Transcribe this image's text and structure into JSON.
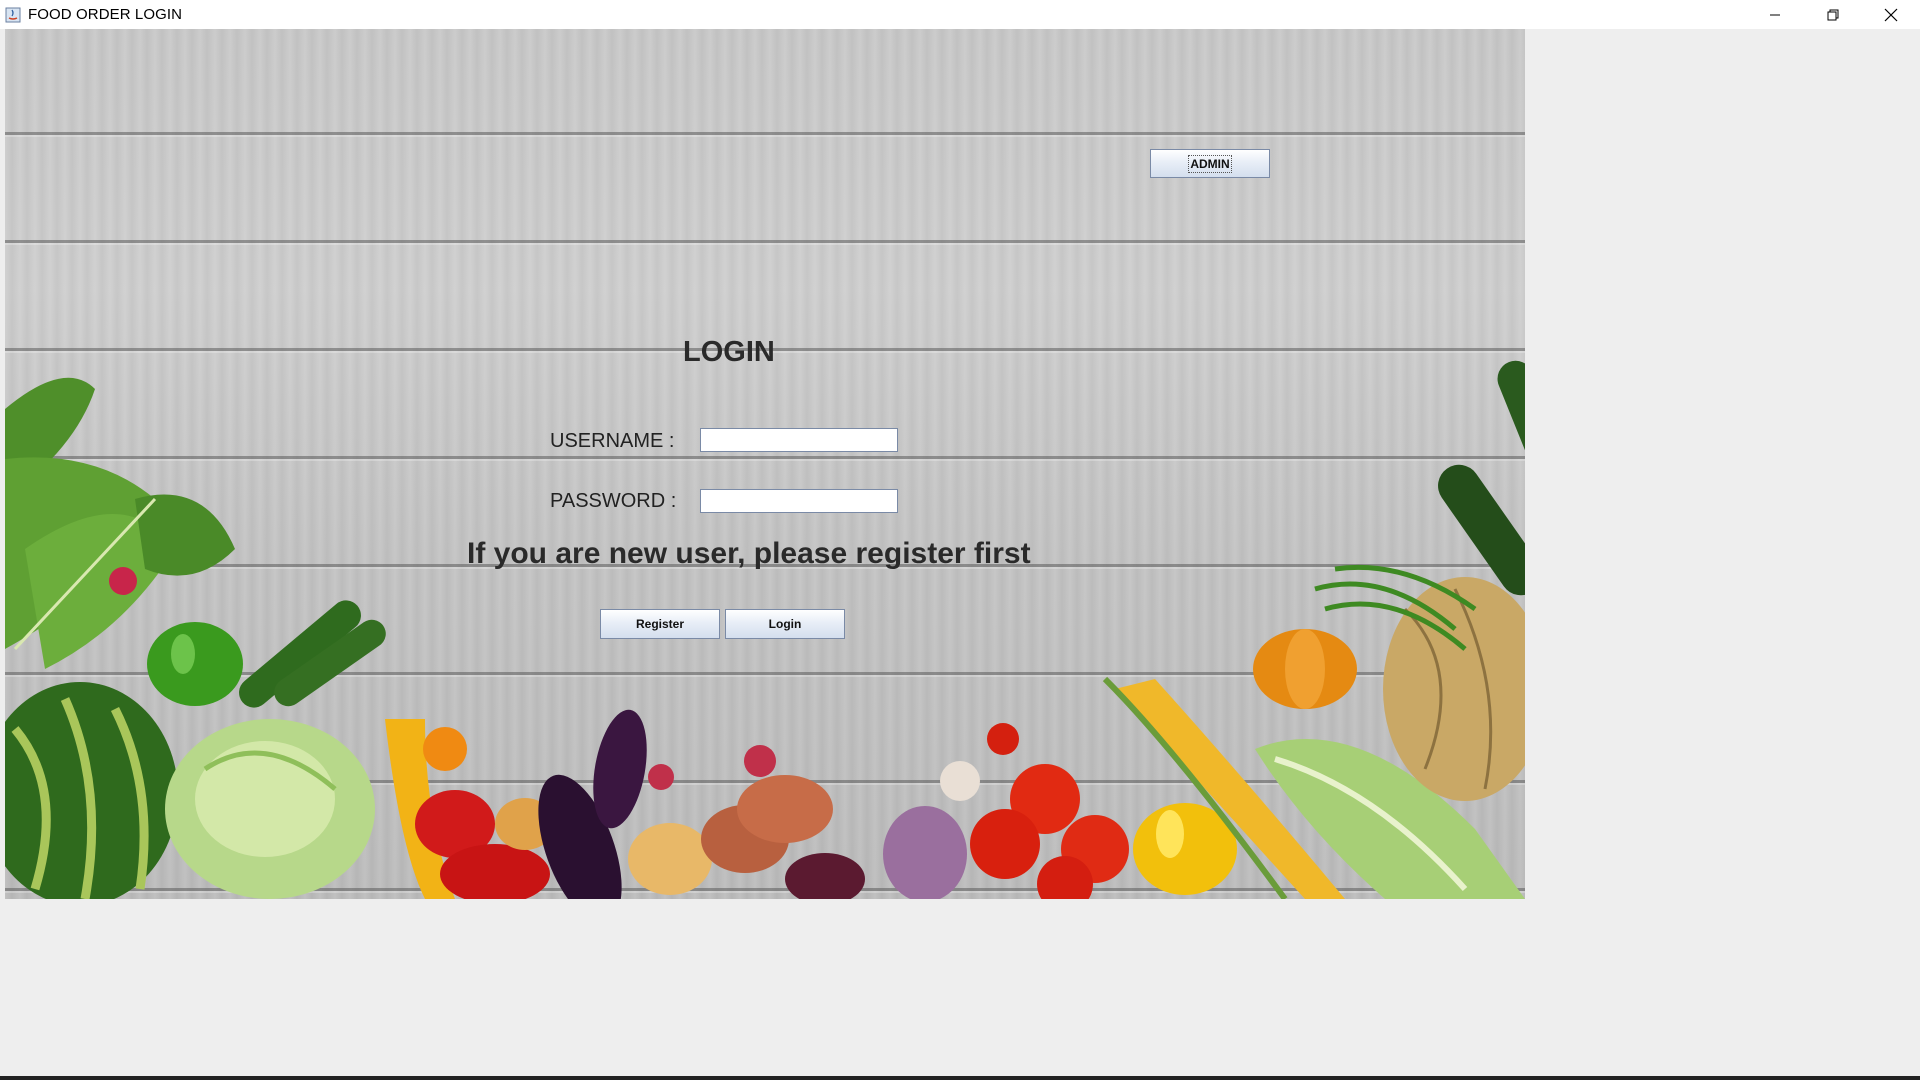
{
  "window": {
    "title": "FOOD ORDER LOGIN",
    "controls": [
      "minimize-icon",
      "restore-icon",
      "close-icon"
    ]
  },
  "admin_button": {
    "label": "ADMIN"
  },
  "login": {
    "heading": "LOGIN",
    "username_label": "USERNAME :",
    "password_label": "PASSWORD :",
    "username_value": "",
    "password_value": "",
    "register_prompt": "If you are new user, please register first",
    "register_label": "Register",
    "login_label": "Login"
  },
  "colors": {
    "titlebar_bg": "#ffffff",
    "window_bg": "#eeeeee",
    "button_border": "#7a8aa6"
  }
}
